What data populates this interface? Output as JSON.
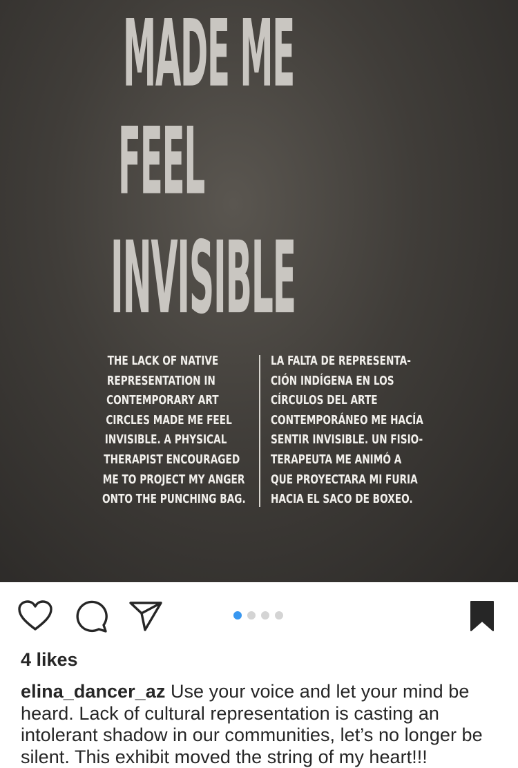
{
  "photo": {
    "headline": [
      "MADE ME",
      "FEEL",
      "INVISIBLE"
    ],
    "text_left": [
      "THE LACK OF NATIVE",
      "REPRESENTATION IN",
      "CONTEMPORARY ART",
      "CIRCLES MADE ME FEEL",
      "INVISIBLE. A PHYSICAL",
      "THERAPIST ENCOURAGED",
      "ME TO PROJECT MY ANGER",
      "ONTO THE PUNCHING BAG."
    ],
    "text_right": [
      "LA FALTA DE REPRESENTA-",
      "CIÓN INDÍGENA EN LOS",
      "CÍRCULOS DEL ARTE",
      "CONTEMPORÁNEO ME HACÍA",
      "SENTIR INVISIBLE. UN FISIO-",
      "TERAPEUTA ME ANIMÓ A",
      "QUE PROYECTARA MI FURIA",
      "HACIA EL SACO DE BOXEO."
    ]
  },
  "actions": {
    "icons": [
      "heart-icon",
      "comment-icon",
      "share-icon",
      "bookmark-icon"
    ],
    "carousel": {
      "count": 4,
      "active_index": 0,
      "active_color": "#3897f0",
      "inactive_color": "#d4d4d4"
    }
  },
  "likes": "4 likes",
  "caption": {
    "username": "elina_dancer_az",
    "text": "Use your voice and let your mind be heard. Lack of cultural representation is casting an intolerant shadow in our communities, let’s no longer be silent. This exhibit moved the string of my heart!!!"
  }
}
